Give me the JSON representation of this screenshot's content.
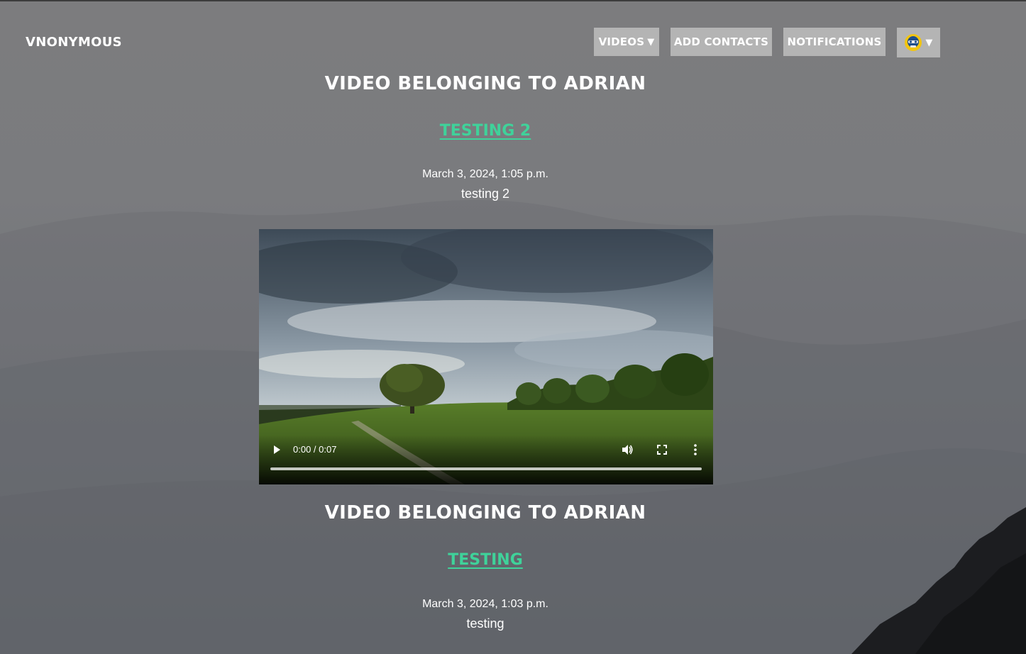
{
  "brand": {
    "name": "VNONYMOUS"
  },
  "nav": {
    "videos_label": "VIDEOS",
    "videos_caret": "▼",
    "add_contacts_label": "ADD CONTACTS",
    "notifications_label": "NOTIFICATIONS",
    "profile_caret": "▼",
    "profile_icon": "avatar-icon"
  },
  "videos": [
    {
      "owner_heading": "VIDEO BELONGING TO ADRIAN",
      "title": "TESTING 2",
      "date": "March 3, 2024, 1:05 p.m.",
      "description": "testing 2",
      "player": {
        "time": "0:00 / 0:07",
        "progress": 0
      }
    },
    {
      "owner_heading": "VIDEO BELONGING TO ADRIAN",
      "title": "TESTING",
      "date": "March 3, 2024, 1:03 p.m.",
      "description": "testing"
    }
  ],
  "colors": {
    "link": "#3fd29a",
    "nav_button": "#b4b4b4"
  }
}
